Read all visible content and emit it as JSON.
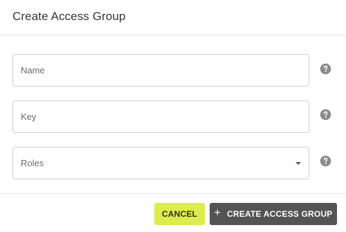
{
  "dialog": {
    "title": "Create Access Group",
    "fields": {
      "name_placeholder": "Name",
      "key_placeholder": "Key",
      "roles_label": "Roles"
    },
    "help_icon": "question-circle-icon",
    "buttons": {
      "cancel_label": "CANCEL",
      "create_icon": "+",
      "create_label": "CREATE ACCESS GROUP"
    },
    "colors": {
      "cancel_button": "#dcec4c",
      "create_button": "#545454",
      "help_icon": "#8a8a8a"
    }
  }
}
